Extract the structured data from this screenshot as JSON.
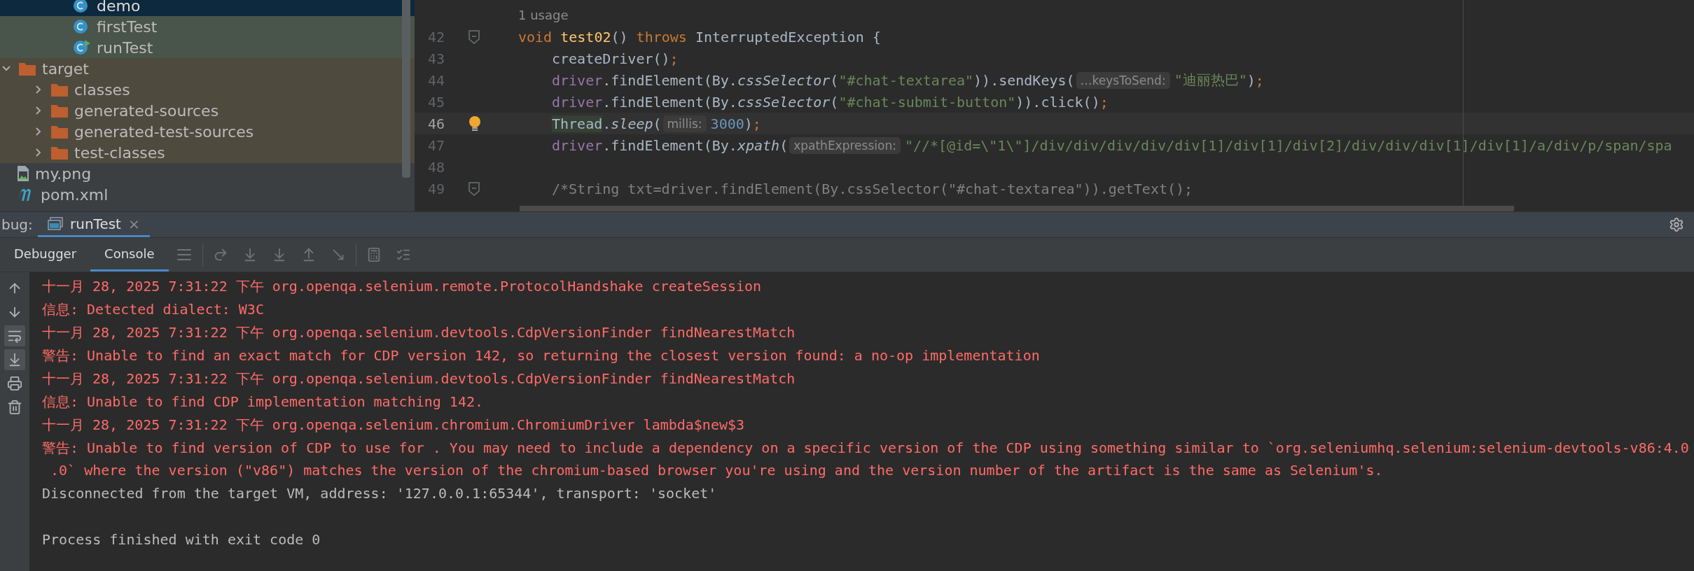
{
  "tree": {
    "package_files": [
      {
        "kind": "class",
        "label": "demo",
        "selected": true,
        "runnable": false
      },
      {
        "kind": "class",
        "label": "firstTest",
        "selected": false,
        "runnable": false,
        "color": "#49544a"
      },
      {
        "kind": "class",
        "label": "runTest",
        "selected": false,
        "runnable": true,
        "color": "#49544a"
      }
    ],
    "items": [
      {
        "kind": "folder",
        "label": "target",
        "expanded": true,
        "color": "#4f4a3e",
        "children": [
          {
            "kind": "folder",
            "label": "classes",
            "expanded": false,
            "color": "#4f4a3e"
          },
          {
            "kind": "folder",
            "label": "generated-sources",
            "expanded": false,
            "color": "#4f4a3e"
          },
          {
            "kind": "folder",
            "label": "generated-test-sources",
            "expanded": false,
            "color": "#4f4a3e"
          },
          {
            "kind": "folder",
            "label": "test-classes",
            "expanded": false,
            "color": "#4f4a3e"
          }
        ]
      },
      {
        "kind": "image",
        "label": "my.png",
        "color": "#3c3f41"
      },
      {
        "kind": "maven",
        "label": "pom.xml",
        "color": "#3c3f41"
      }
    ]
  },
  "editor": {
    "usage": "1 usage",
    "lines": [
      {
        "number": "42",
        "fold": true,
        "current": false,
        "bulb": false,
        "tokens": [
          {
            "kind": "keyword",
            "text": "void "
          },
          {
            "kind": "method",
            "text": "test02"
          },
          {
            "kind": "plain",
            "text": "() "
          },
          {
            "kind": "keyword",
            "text": "throws "
          },
          {
            "kind": "plain",
            "text": "InterruptedException {"
          }
        ],
        "children": [
          {
            "number": "43",
            "current": false,
            "bulb": false,
            "tokens": [
              {
                "kind": "plain",
                "text": "createDriver()"
              },
              {
                "kind": "keyword",
                "text": ";"
              }
            ]
          },
          {
            "number": "44",
            "current": false,
            "bulb": false,
            "tokens": [
              {
                "kind": "field",
                "text": "driver"
              },
              {
                "kind": "plain",
                "text": ".findElement(By."
              },
              {
                "kind": "static",
                "text": "cssSelector"
              },
              {
                "kind": "plain",
                "text": "("
              },
              {
                "kind": "string",
                "text": "\"#chat-textarea\""
              },
              {
                "kind": "plain",
                "text": ")).sendKeys("
              },
              {
                "kind": "hint",
                "text": "…keysToSend:"
              },
              {
                "kind": "string",
                "text": "\"迪丽热巴\""
              },
              {
                "kind": "plain",
                "text": ")"
              },
              {
                "kind": "keyword",
                "text": ";"
              }
            ]
          },
          {
            "number": "45",
            "current": false,
            "bulb": false,
            "tokens": [
              {
                "kind": "field",
                "text": "driver"
              },
              {
                "kind": "plain",
                "text": ".findElement(By."
              },
              {
                "kind": "static",
                "text": "cssSelector"
              },
              {
                "kind": "plain",
                "text": "("
              },
              {
                "kind": "string",
                "text": "\"#chat-submit-button\""
              },
              {
                "kind": "plain",
                "text": ")).click()"
              },
              {
                "kind": "keyword",
                "text": ";"
              }
            ]
          },
          {
            "number": "46",
            "current": true,
            "bulb": true,
            "tokens": [
              {
                "kind": "marked",
                "text": "Thread"
              },
              {
                "kind": "plain",
                "text": "."
              },
              {
                "kind": "static",
                "text": "sleep"
              },
              {
                "kind": "plain",
                "text": "("
              },
              {
                "kind": "hint",
                "text": "millis:"
              },
              {
                "kind": "number",
                "text": "3000"
              },
              {
                "kind": "plain",
                "text": ")"
              },
              {
                "kind": "keyword",
                "text": ";"
              }
            ]
          },
          {
            "number": "47",
            "current": false,
            "bulb": false,
            "tokens": [
              {
                "kind": "field",
                "text": "driver"
              },
              {
                "kind": "plain",
                "text": ".findElement(By."
              },
              {
                "kind": "static",
                "text": "xpath"
              },
              {
                "kind": "plain",
                "text": "("
              },
              {
                "kind": "hint",
                "text": "xpathExpression:"
              },
              {
                "kind": "string",
                "text": "\"//*[@id=\\\"1\\\"]/div/div/div/div/div[1]/div[1]/div[2]/div/div/div[1]/div[1]/a/div/p/span/spa"
              }
            ]
          },
          {
            "number": "48",
            "current": false,
            "bulb": false
          },
          {
            "number": "49",
            "fold": true,
            "current": false,
            "bulb": false,
            "tokens": [
              {
                "kind": "comment",
                "text": "/*String txt=driver.findElement(By.cssSelector(\"#chat-textarea\")).getText();"
              }
            ]
          }
        ]
      }
    ]
  },
  "debug": {
    "label": "bug:",
    "tab": {
      "title": "runTest",
      "close": "×"
    },
    "tabs": [
      {
        "label": "Debugger",
        "selected": false
      },
      {
        "label": "Console",
        "selected": true
      }
    ],
    "console_tools": [
      {
        "kind": "up",
        "on": false
      },
      {
        "kind": "down",
        "on": false
      },
      {
        "kind": "wrap",
        "on": true
      },
      {
        "kind": "scroll",
        "on": true
      },
      {
        "kind": "print",
        "on": false
      },
      {
        "kind": "clear",
        "on": false
      }
    ],
    "console": [
      {
        "kind": "error",
        "text": "十一月 28, 2025 7:31:22 下午 org.openqa.selenium.remote.ProtocolHandshake createSession"
      },
      {
        "kind": "error",
        "text": "信息: Detected dialect: W3C"
      },
      {
        "kind": "error",
        "text": "十一月 28, 2025 7:31:22 下午 org.openqa.selenium.devtools.CdpVersionFinder findNearestMatch"
      },
      {
        "kind": "error",
        "text": "警告: Unable to find an exact match for CDP version 142, so returning the closest version found: a no-op implementation"
      },
      {
        "kind": "error",
        "text": "十一月 28, 2025 7:31:22 下午 org.openqa.selenium.devtools.CdpVersionFinder findNearestMatch"
      },
      {
        "kind": "error",
        "text": "信息: Unable to find CDP implementation matching 142."
      },
      {
        "kind": "error",
        "text": "十一月 28, 2025 7:31:22 下午 org.openqa.selenium.chromium.ChromiumDriver lambda$new$3"
      },
      {
        "kind": "error",
        "text": "警告: Unable to find version of CDP to use for . You may need to include a dependency on a specific version of the CDP using something similar to `org.seleniumhq.selenium:selenium-devtools-v86:4.0"
      },
      {
        "kind": "error",
        "text": " .0` where the version (\"v86\") matches the version of the chromium-based browser you're using and the version number of the artifact is the same as Selenium's."
      },
      {
        "kind": "output",
        "text": "Disconnected from the target VM, address: '127.0.0.1:65344', transport: 'socket'"
      },
      {
        "kind": "blank"
      },
      {
        "kind": "output",
        "text": "Process finished with exit code 0"
      }
    ]
  }
}
